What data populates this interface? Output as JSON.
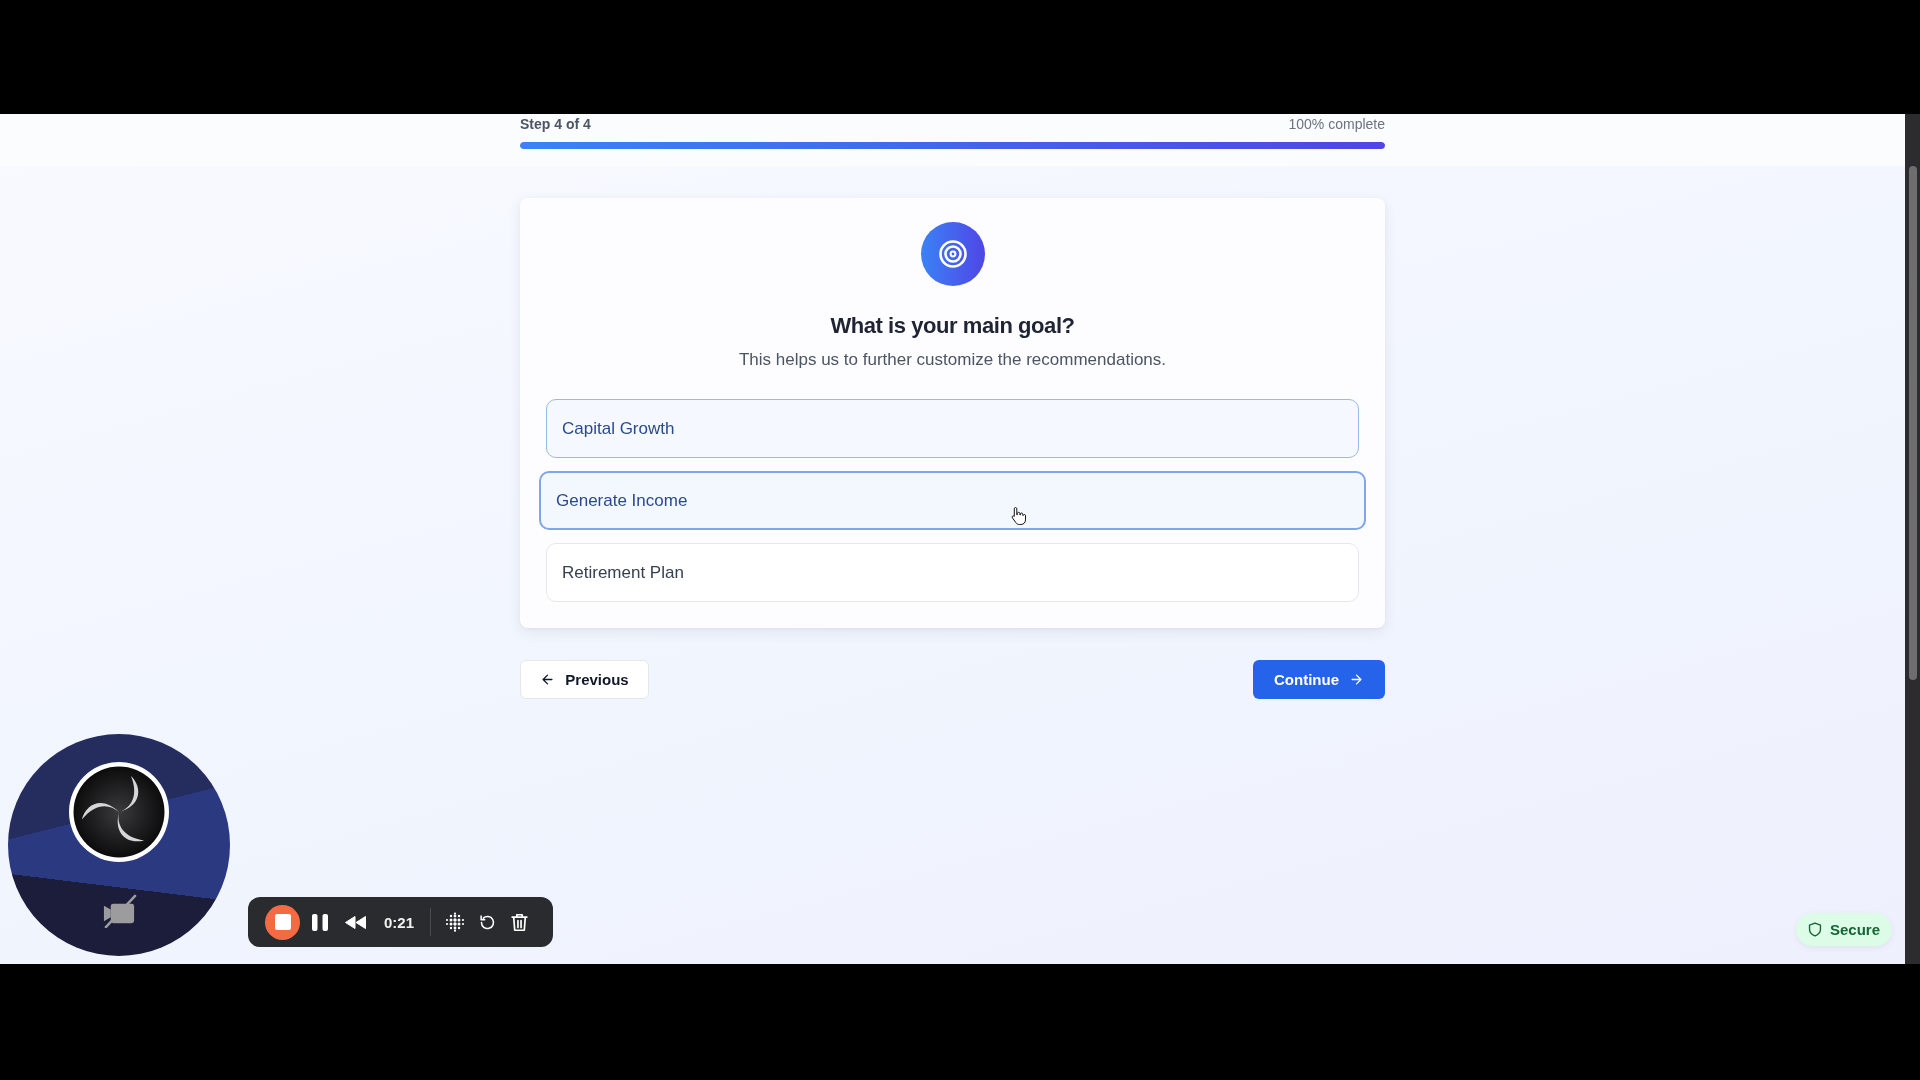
{
  "progress": {
    "step_label": "Step 4 of 4",
    "percent_label": "100% complete",
    "level": 1
  },
  "question": {
    "title": "What is your main goal?",
    "subtitle": "This helps us to further customize the recommendations."
  },
  "options": [
    {
      "label": "Capital Growth",
      "selected": true,
      "hovered": false
    },
    {
      "label": "Generate Income",
      "selected": false,
      "hovered": true
    },
    {
      "label": "Retirement Plan",
      "selected": false,
      "hovered": false
    }
  ],
  "navigation": {
    "previous": "Previous",
    "continue": "Continue"
  },
  "recorder": {
    "time": "0:21"
  },
  "security_badge": {
    "label": "Secure"
  }
}
